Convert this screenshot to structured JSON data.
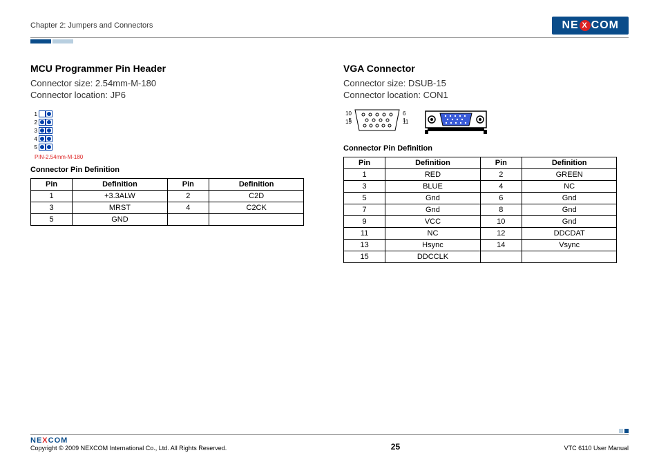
{
  "header": {
    "chapter": "Chapter 2: Jumpers and Connectors",
    "logo_left": "NE",
    "logo_x": "X",
    "logo_right": "COM"
  },
  "left": {
    "title": "MCU Programmer Pin Header",
    "size": "Connector size: 2.54mm-M-180",
    "location": "Connector location: JP6",
    "pin_label": "PIN-2.54mm-M-180",
    "pins": [
      "1",
      "2",
      "3",
      "4",
      "5"
    ],
    "table_title": "Connector Pin Definition",
    "th": [
      "Pin",
      "Definition",
      "Pin",
      "Definition"
    ],
    "rows": [
      [
        "1",
        "+3.3ALW",
        "2",
        "C2D"
      ],
      [
        "3",
        "MRST",
        "4",
        "C2CK"
      ],
      [
        "5",
        "GND",
        "",
        ""
      ]
    ]
  },
  "right": {
    "title": "VGA Connector",
    "size": "Connector size: DSUB-15",
    "location": "Connector location: CON1",
    "diagram_nums": {
      "r1l": "5",
      "r1r": "1",
      "r2l": "10",
      "r2r": "6",
      "r3l": "15",
      "r3r": "11"
    },
    "table_title": "Connector Pin Definition",
    "th": [
      "Pin",
      "Definition",
      "Pin",
      "Definition"
    ],
    "rows": [
      [
        "1",
        "RED",
        "2",
        "GREEN"
      ],
      [
        "3",
        "BLUE",
        "4",
        "NC"
      ],
      [
        "5",
        "Gnd",
        "6",
        "Gnd"
      ],
      [
        "7",
        "Gnd",
        "8",
        "Gnd"
      ],
      [
        "9",
        "VCC",
        "10",
        "Gnd"
      ],
      [
        "11",
        "NC",
        "12",
        "DDCDAT"
      ],
      [
        "13",
        "Hsync",
        "14",
        "Vsync"
      ],
      [
        "15",
        "DDCCLK",
        "",
        ""
      ]
    ]
  },
  "footer": {
    "logo_left": "NE",
    "logo_x": "X",
    "logo_right": "COM",
    "copyright": "Copyright © 2009 NEXCOM International Co., Ltd. All Rights Reserved.",
    "page": "25",
    "manual": "VTC 6110 User Manual"
  }
}
